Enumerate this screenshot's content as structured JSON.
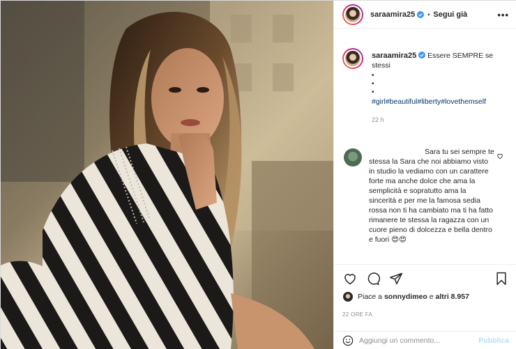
{
  "post": {
    "username": "saraamira25",
    "follow_status": "Segui già",
    "caption": {
      "text": "Essere SEMPRE se stessi",
      "bullets": [
        "•",
        "•",
        "•"
      ],
      "hashtags": "#girl#beautiful#liberty#lovethemself",
      "time": "22 h"
    }
  },
  "comment": {
    "text_first": "Sara tu sei",
    "text_rest": "sempre te stessa la Sara che noi abbiamo visto in studio la vediamo con un carattere forte ma anche dolce che ama la semplicità e sopratutto ama la sincerità e per me la famosa sedia rossa non ti ha cambiato ma ti ha fatto rimanere te stessa la ragazza con un cuore pieno di dolcezza e bella dentro e fuori 😍😍"
  },
  "likes": {
    "prefix": "Piace a ",
    "user": "sonnydimeo",
    "middle": " e ",
    "others": "altri 8.957"
  },
  "timestamp": "22 ORE FA",
  "add_comment": {
    "placeholder": "Aggiungi un commento...",
    "publish_label": "Pubblica"
  },
  "icons": {
    "more": "more-options-icon",
    "heart": "heart-icon",
    "comment": "comment-icon",
    "share": "share-icon",
    "save": "bookmark-icon",
    "emoji": "emoji-icon",
    "verified": "verified-badge-icon"
  },
  "colors": {
    "link": "#00376b",
    "verified": "#3897f0",
    "publish_disabled": "#b2dffc",
    "muted": "#8e8e8e"
  }
}
